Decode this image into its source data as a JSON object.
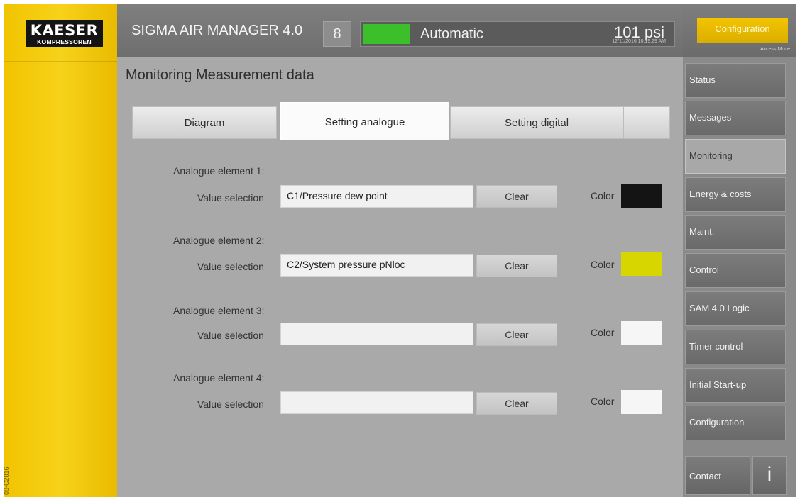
{
  "brand": {
    "logo_main": "KAESER",
    "logo_sub": "KOMPRESSOREN",
    "doc_code": "08-C2016"
  },
  "header": {
    "title": "SIGMA AIR MANAGER 4.0",
    "unit_number": "8",
    "status_text": "Automatic",
    "status_color": "#3bbf2b",
    "pressure": "101 psi",
    "datetime": "12/11/2016 10:19:29 AM"
  },
  "config": {
    "button_label": "Configuration",
    "access_mode": "Access Mode"
  },
  "page": {
    "title": "Monitoring  Measurement data"
  },
  "tabs": [
    {
      "label": "Diagram",
      "active": false
    },
    {
      "label": "Setting analogue",
      "active": true
    },
    {
      "label": "Setting digital",
      "active": false
    },
    {
      "label": "",
      "active": false
    }
  ],
  "analogue_elements": [
    {
      "heading": "Analogue element 1:",
      "value_label": "Value selection",
      "value": "C1/Pressure dew point",
      "clear_label": "Clear",
      "color_label": "Color",
      "color": "#141414"
    },
    {
      "heading": "Analogue element 2:",
      "value_label": "Value selection",
      "value": "C2/System pressure pNloc",
      "clear_label": "Clear",
      "color_label": "Color",
      "color": "#d8d600"
    },
    {
      "heading": "Analogue element 3:",
      "value_label": "Value selection",
      "value": "",
      "clear_label": "Clear",
      "color_label": "Color",
      "color": "#f6f6f6"
    },
    {
      "heading": "Analogue element 4:",
      "value_label": "Value selection",
      "value": "",
      "clear_label": "Clear",
      "color_label": "Color",
      "color": "#f6f6f6"
    }
  ],
  "nav": {
    "items": [
      {
        "label": "Status",
        "active": false
      },
      {
        "label": "Messages",
        "active": false
      },
      {
        "label": "Monitoring",
        "active": true
      },
      {
        "label": "Energy & costs",
        "active": false
      },
      {
        "label": "Maint.",
        "active": false
      },
      {
        "label": "Control",
        "active": false
      },
      {
        "label": "SAM 4.0 Logic",
        "active": false
      },
      {
        "label": "Timer control",
        "active": false
      },
      {
        "label": "Initial Start-up",
        "active": false
      },
      {
        "label": "Configuration",
        "active": false
      }
    ],
    "contact_label": "Contact",
    "info_label": "i"
  }
}
